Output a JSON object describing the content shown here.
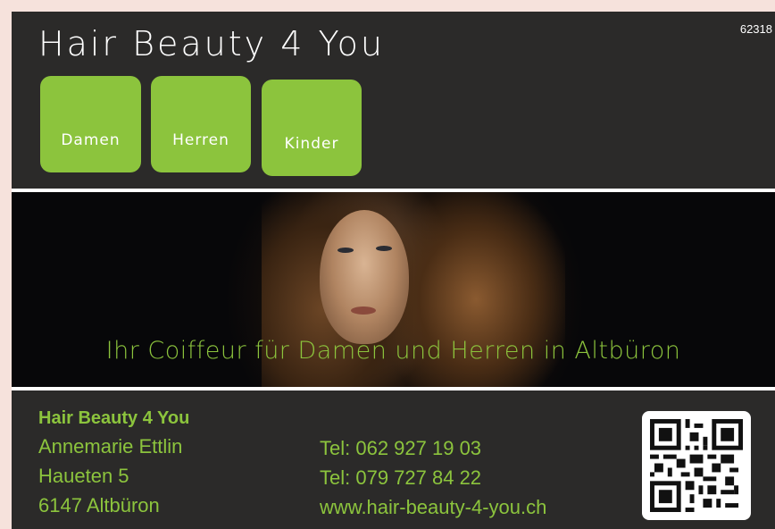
{
  "ad_number": "62318",
  "brand_title": "Hair Beauty 4 You",
  "categories": [
    {
      "label": "Damen"
    },
    {
      "label": "Herren"
    },
    {
      "label": "Kinder"
    }
  ],
  "tagline": "Ihr Coiffeur für Damen und Herren in Altbüron",
  "contact": {
    "business_name": "Hair Beauty 4 You",
    "owner": "Annemarie Ettlin",
    "street": "Haueten 5",
    "city": "6147 Altbüron",
    "phone1": "Tel: 062 927 19 03",
    "phone2": "Tel: 079 727 84 22",
    "website": "www.hair-beauty-4-you.ch"
  },
  "colors": {
    "accent": "#8cc43d",
    "background": "#2b2a29",
    "page": "#f6e2dc"
  },
  "icons": {
    "qr": "qr-code-icon"
  }
}
